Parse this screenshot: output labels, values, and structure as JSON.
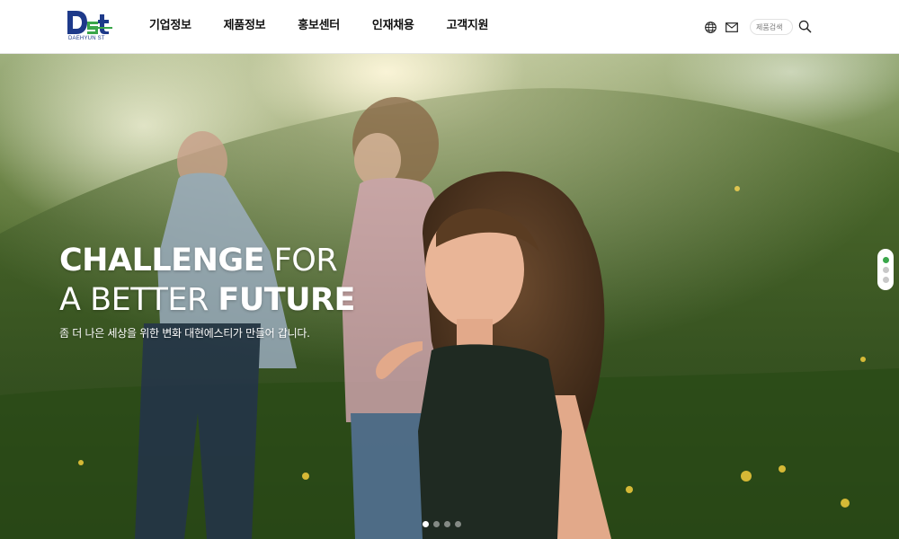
{
  "brand": {
    "logo_text": "Dst",
    "logo_sub": "DAEHYUN ST",
    "colors": {
      "green": "#3aa64a",
      "navy": "#1e3a8a"
    }
  },
  "nav": {
    "items": [
      "기업정보",
      "제품정보",
      "홍보센터",
      "인재채용",
      "고객지원"
    ]
  },
  "utils": {
    "language_icon": "globe-icon",
    "mail_icon": "mail-icon",
    "search_placeholder": "제품검색",
    "search_icon": "search-icon"
  },
  "hero": {
    "title_line1_bold": "CHALLENGE",
    "title_line1_light": "FOR",
    "title_line2_light": "A BETTER",
    "title_line2_bold": "FUTURE",
    "subtitle": "좀 더 나은 세상을 위한 변화 대현에스티가 만들어 갑니다."
  },
  "side_nav": {
    "count": 3,
    "active_index": 0
  },
  "pager": {
    "count": 4,
    "active_index": 0
  }
}
